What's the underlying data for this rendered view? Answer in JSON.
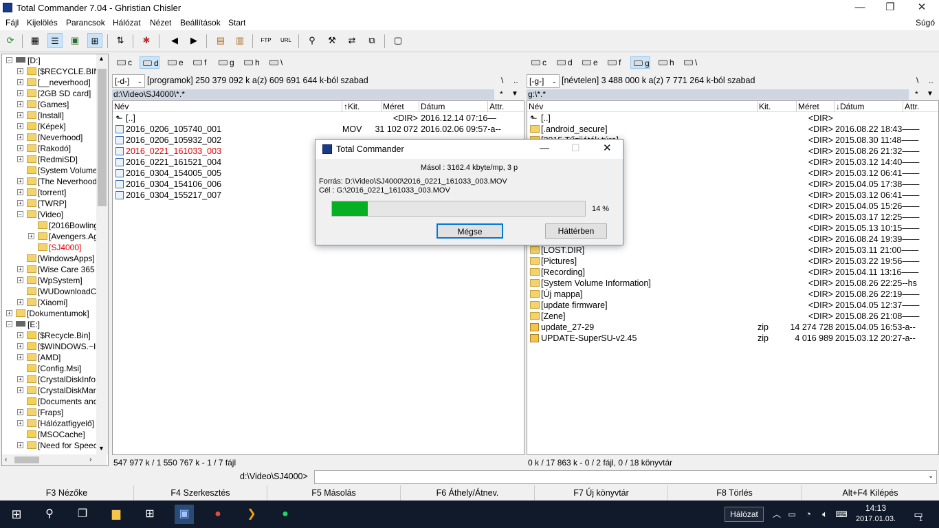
{
  "window": {
    "title": "Total Commander 7.04 - Ghristian Chisler",
    "minimize": "—",
    "restore": "❐",
    "close": "✕"
  },
  "menu": [
    "Fájl",
    "Kijelölés",
    "Parancsok",
    "Hálózat",
    "Nézet",
    "Beállítások",
    "Start"
  ],
  "menu_help": "Súgó",
  "tree": [
    {
      "label": "[D:]",
      "depth": 0,
      "drive": true,
      "exp": "−"
    },
    {
      "label": "[$RECYCLE.BIN",
      "depth": 1,
      "warn": true,
      "exp": "+"
    },
    {
      "label": "[__neverhood]",
      "depth": 1,
      "exp": "+"
    },
    {
      "label": "[2GB SD card]",
      "depth": 1,
      "exp": "+"
    },
    {
      "label": "[Games]",
      "depth": 1,
      "exp": "+"
    },
    {
      "label": "[Install]",
      "depth": 1,
      "exp": "+"
    },
    {
      "label": "[Képek]",
      "depth": 1,
      "warn": true,
      "exp": "+"
    },
    {
      "label": "[Neverhood]",
      "depth": 1,
      "exp": "+"
    },
    {
      "label": "[Rakodó]",
      "depth": 1,
      "exp": "+"
    },
    {
      "label": "[RedmiSD]",
      "depth": 1,
      "exp": "+"
    },
    {
      "label": "[System Volume",
      "depth": 1,
      "warn": true
    },
    {
      "label": "[The Neverhood",
      "depth": 1,
      "exp": "+"
    },
    {
      "label": "[torrent]",
      "depth": 1,
      "exp": "+"
    },
    {
      "label": "[TWRP]",
      "depth": 1,
      "exp": "+"
    },
    {
      "label": "[Video]",
      "depth": 1,
      "exp": "−"
    },
    {
      "label": "[2016Bowling",
      "depth": 2
    },
    {
      "label": "[Avengers.Ag",
      "depth": 2,
      "exp": "+"
    },
    {
      "label": "[SJ4000]",
      "depth": 2,
      "red": true
    },
    {
      "label": "[WindowsApps]",
      "depth": 1
    },
    {
      "label": "[Wise Care 365",
      "depth": 1,
      "exp": "+"
    },
    {
      "label": "[WpSystem]",
      "depth": 1,
      "exp": "+"
    },
    {
      "label": "[WUDownloadC",
      "depth": 1
    },
    {
      "label": "[Xiaomi]",
      "depth": 1,
      "exp": "+"
    },
    {
      "label": "[Dokumentumok]",
      "depth": 0,
      "exp": "+"
    },
    {
      "label": "[E:]",
      "depth": 0,
      "drive": true,
      "exp": "−"
    },
    {
      "label": "[$Recycle.Bin]",
      "depth": 1,
      "warn": true,
      "exp": "+"
    },
    {
      "label": "[$WINDOWS.~I",
      "depth": 1,
      "warn": true,
      "exp": "+"
    },
    {
      "label": "[AMD]",
      "depth": 1,
      "exp": "+"
    },
    {
      "label": "[Config.Msi]",
      "depth": 1,
      "warn": true
    },
    {
      "label": "[CrystalDiskInfo",
      "depth": 1,
      "exp": "+"
    },
    {
      "label": "[CrystalDiskMarl",
      "depth": 1,
      "exp": "+"
    },
    {
      "label": "[Documents and",
      "depth": 1,
      "warn": true
    },
    {
      "label": "[Fraps]",
      "depth": 1,
      "exp": "+"
    },
    {
      "label": "[Hálózatfigyelő]",
      "depth": 1,
      "exp": "+"
    },
    {
      "label": "[MSOCache]",
      "depth": 1,
      "warn": true
    },
    {
      "label": "[Need for Speec",
      "depth": 1,
      "exp": "+"
    }
  ],
  "left": {
    "drives": [
      "c",
      "d",
      "e",
      "f",
      "g",
      "h",
      "\\"
    ],
    "selected_drive": "d",
    "combo": "[-d-]",
    "info": "[programok]  250 379 092 k a(z) 609 691 644 k-ból szabad",
    "root_btn": "\\",
    "up_btn": "..",
    "path": "d:\\Video\\SJ4000\\*.*",
    "filter": "*",
    "cols": {
      "name": "Név",
      "ext": "↑Kit.",
      "size": "Méret",
      "date": "Dátum",
      "attr": "Attr."
    },
    "files": [
      {
        "name": "[..]",
        "ext": "",
        "size": "<DIR>",
        "date": "2016.12.14 07:16—",
        "up": true
      },
      {
        "name": "2016_0206_105740_001",
        "ext": "MOV",
        "size": "31 102 072",
        "date": "2016.02.06 09:57-a--"
      },
      {
        "name": "2016_0206_105932_002",
        "ext": "",
        "size": "",
        "date": ""
      },
      {
        "name": "2016_0221_161033_003",
        "ext": "",
        "size": "",
        "date": "",
        "red": true
      },
      {
        "name": "2016_0221_161521_004",
        "ext": "",
        "size": "",
        "date": ""
      },
      {
        "name": "2016_0304_154005_005",
        "ext": "",
        "size": "",
        "date": ""
      },
      {
        "name": "2016_0304_154106_006",
        "ext": "",
        "size": "",
        "date": ""
      },
      {
        "name": "2016_0304_155217_007",
        "ext": "",
        "size": "",
        "date": ""
      }
    ],
    "status": "547 977 k / 1 550 767 k - 1 / 7 fájl"
  },
  "right": {
    "drives": [
      "c",
      "d",
      "e",
      "f",
      "g",
      "h",
      "\\"
    ],
    "selected_drive": "g",
    "combo": "[-g-]",
    "info": "[névtelen]  3 488 000 k a(z) 7 771 264 k-ból szabad",
    "root_btn": "\\",
    "up_btn": "..",
    "path": "g:\\*.*",
    "filter": "*",
    "cols": {
      "name": "Név",
      "ext": "Kit.",
      "size": "Méret",
      "date": "↓Dátum",
      "attr": "Attr."
    },
    "files": [
      {
        "name": "[..]",
        "ext": "",
        "size": "<DIR>",
        "date": "",
        "up": true
      },
      {
        "name": "[.android_secure]",
        "ext": "",
        "size": "<DIR>",
        "date": "2016.08.22 18:43——"
      },
      {
        "name": "[2015 Tűzijáték túra]",
        "ext": "",
        "size": "<DIR>",
        "date": "2015.08.30 11:48——"
      },
      {
        "name": "",
        "ext": "",
        "size": "<DIR>",
        "date": "2015.08.26 21:32——"
      },
      {
        "name": "",
        "ext": "",
        "size": "<DIR>",
        "date": "2015.03.12 14:40——"
      },
      {
        "name": "",
        "ext": "",
        "size": "<DIR>",
        "date": "2015.03.12 06:41——"
      },
      {
        "name": "",
        "ext": "",
        "size": "<DIR>",
        "date": "2015.04.05 17:38——"
      },
      {
        "name": "",
        "ext": "",
        "size": "<DIR>",
        "date": "2015.03.12 06:41——"
      },
      {
        "name": "",
        "ext": "",
        "size": "<DIR>",
        "date": "2015.04.05 15:26——"
      },
      {
        "name": "",
        "ext": "",
        "size": "<DIR>",
        "date": "2015.03.17 12:25——"
      },
      {
        "name": "",
        "ext": "",
        "size": "<DIR>",
        "date": "2015.05.13 10:15——"
      },
      {
        "name": "",
        "ext": "",
        "size": "<DIR>",
        "date": "2016.08.24 19:39——"
      },
      {
        "name": "[LOST.DIR]",
        "ext": "",
        "size": "<DIR>",
        "date": "2015.03.11 21:00——"
      },
      {
        "name": "[Pictures]",
        "ext": "",
        "size": "<DIR>",
        "date": "2015.03.22 19:56——"
      },
      {
        "name": "[Recording]",
        "ext": "",
        "size": "<DIR>",
        "date": "2015.04.11 13:16——"
      },
      {
        "name": "[System Volume Information]",
        "ext": "",
        "size": "<DIR>",
        "date": "2015.08.26 22:25--hs",
        "warn": true
      },
      {
        "name": "[Új mappa]",
        "ext": "",
        "size": "<DIR>",
        "date": "2015.08.26 22:19——"
      },
      {
        "name": "[update firmware]",
        "ext": "",
        "size": "<DIR>",
        "date": "2015.04.05 12:37——"
      },
      {
        "name": "[Zene]",
        "ext": "",
        "size": "<DIR>",
        "date": "2015.08.26 21:08——"
      },
      {
        "name": "update_27-29",
        "ext": "zip",
        "size": "14 274 728",
        "date": "2015.04.05 16:53-a--",
        "zip": true
      },
      {
        "name": "UPDATE-SuperSU-v2.45",
        "ext": "zip",
        "size": "4 016 989",
        "date": "2015.03.12 20:27-a--",
        "zip": true
      }
    ],
    "status": "0 k / 17 863 k - 0 / 2 fájl, 0 / 18 könyvtár"
  },
  "cmdline": {
    "prompt": "d:\\Video\\SJ4000>",
    "value": ""
  },
  "fkeys": [
    "F3 Nézőke",
    "F4 Szerkesztés",
    "F5 Másolás",
    "F6 Áthely/Átnev.",
    "F7 Új könyvtár",
    "F8 Törlés",
    "Alt+F4 Kilépés"
  ],
  "dialog": {
    "title": "Total Commander",
    "speed": "Másol : 3162.4 kbyte/mp, 3 p",
    "source": "Forrás:  D:\\Video\\SJ4000\\2016_0221_161033_003.MOV",
    "target": "Cél   : G:\\2016_0221_161033_003.MOV",
    "progress": 0.14,
    "percent": "14 %",
    "cancel": "Mégse",
    "background": "Háttérben"
  },
  "taskbar": {
    "network_tooltip": "Hálózat",
    "time": "14:13",
    "date": "2017.01.03.",
    "notif_count": "1"
  },
  "colors": {
    "accent": "#cce4f7",
    "progress": "#06b025",
    "highlight_red": "#e00000",
    "path_bar": "#cfd6e2"
  }
}
